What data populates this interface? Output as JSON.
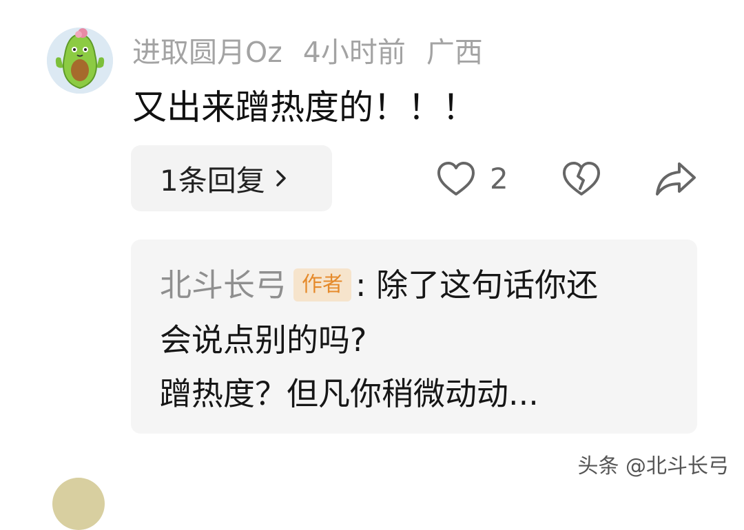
{
  "comment": {
    "username": "进取圆月Oz",
    "time": "4小时前",
    "location": "广西",
    "text": "又出来蹭热度的！！！",
    "avatar_icon": "avocado-avatar-icon"
  },
  "actions": {
    "replies_label": "1条回复",
    "like_count": "2",
    "like_icon": "heart-outline-icon",
    "dislike_icon": "broken-heart-icon",
    "share_icon": "share-arrow-icon"
  },
  "reply": {
    "author": "北斗长弓",
    "badge": "作者",
    "line1": ": 除了这句话你还",
    "line2": "会说点别的吗?",
    "line3": "蹭热度？但凡你稍微动动..."
  },
  "watermark": "头条 @北斗长弓",
  "colors": {
    "meta_gray": "#a3a3a3",
    "panel_bg": "#f5f5f5",
    "badge_bg": "#f6e4cc",
    "badge_text": "#e58a2b",
    "avatar_green": "#7cbf3a"
  }
}
